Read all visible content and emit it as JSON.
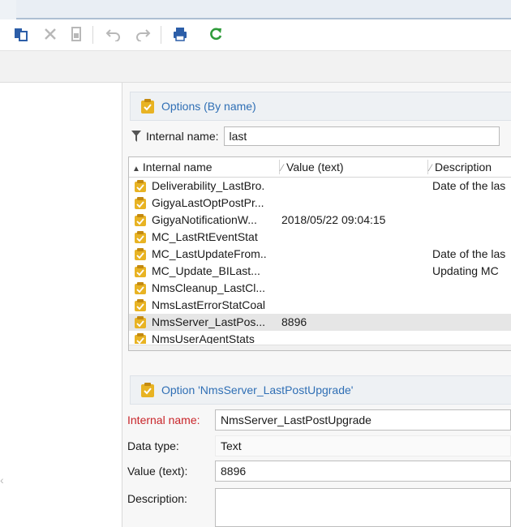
{
  "toolbar": {
    "icons": [
      "copy-icon",
      "delete-icon",
      "duplicate-icon",
      "undo-icon",
      "redo-icon",
      "print-icon",
      "refresh-icon"
    ],
    "colors": {
      "blue": "#2c5ea8",
      "green": "#2e9b3a",
      "grey": "#b8b8b8"
    }
  },
  "options_panel": {
    "title": "Options (By name)",
    "filter_label": "Internal name:",
    "filter_value": "last"
  },
  "grid": {
    "columns": [
      "Internal name",
      "Value (text)",
      "Description"
    ],
    "sort_indicator": "▲",
    "rows": [
      {
        "name": "Deliverability_LastBro.",
        "value": "",
        "description": "Date of the las"
      },
      {
        "name": "GigyaLastOptPostPr...",
        "value": "",
        "description": ""
      },
      {
        "name": "GigyaNotificationW...",
        "value": "2018/05/22 09:04:15",
        "description": ""
      },
      {
        "name": "MC_LastRtEventStat",
        "value": "",
        "description": ""
      },
      {
        "name": "MC_LastUpdateFrom..",
        "value": "",
        "description": "Date of the las"
      },
      {
        "name": "MC_Update_BILast...",
        "value": "",
        "description": "Updating MC"
      },
      {
        "name": "NmsCleanup_LastCl...",
        "value": "",
        "description": ""
      },
      {
        "name": "NmsLastErrorStatCoal",
        "value": "",
        "description": ""
      },
      {
        "name": "NmsServer_LastPos...",
        "value": "8896",
        "description": "",
        "selected": true
      },
      {
        "name": "NmsUserAgentStats",
        "value": "",
        "description": ""
      }
    ]
  },
  "detail": {
    "title": "Option 'NmsServer_LastPostUpgrade'",
    "internal_name_label": "Internal name:",
    "internal_name_value": "NmsServer_LastPostUpgrade",
    "data_type_label": "Data type:",
    "data_type_value": "Text",
    "value_label": "Value (text):",
    "value_value": "8896",
    "description_label": "Description:",
    "description_value": ""
  },
  "colors": {
    "link_blue": "#2f6fb5",
    "required_red": "#c8252a",
    "folder_yellow": "#e8b323"
  }
}
